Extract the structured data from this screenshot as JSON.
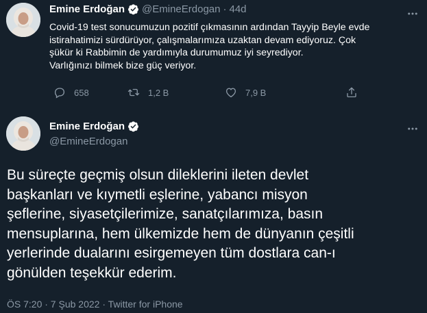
{
  "tweet1": {
    "author_name": "Emine Erdoğan",
    "handle": "@EmineErdogan",
    "separator": "·",
    "age": "44d",
    "text_lines": [
      "Covid-19 test sonucumuzun pozitif çıkmasının ardından Tayyip Beyle evde",
      "istirahatimizi sürdürüyor, çalışmalarımıza uzaktan devam ediyoruz. Çok",
      "şükür ki Rabbimin de yardımıyla durumumuz iyi seyrediyor.",
      "Varlığınızı bilmek bize güç veriyor."
    ],
    "actions": {
      "reply_count": "658",
      "retweet_count": "1,2 B",
      "like_count": "7,9 B"
    }
  },
  "tweet2": {
    "author_name": "Emine Erdoğan",
    "handle": "@EmineErdogan",
    "text_lines": [
      "Bu süreçte geçmiş olsun dileklerini ileten devlet",
      "başkanları ve kıymetli eşlerine, yabancı misyon",
      "şeflerine, siyasetçilerimize, sanatçılarımıza, basın",
      "mensuplarına, hem ülkemizde hem de dünyanın çeşitli",
      "yerlerinde dualarını esirgemeyen tüm dostlara can-ı",
      "gönülden teşekkür ederim."
    ],
    "meta": "ÖS 7:20 · 7 Şub 2022 · Twitter for iPhone"
  },
  "icons": {
    "verified": "verified-badge-icon",
    "more": "more-options-icon",
    "reply": "reply-icon",
    "retweet": "retweet-icon",
    "like": "heart-icon",
    "share": "share-icon"
  },
  "colors": {
    "background": "#15202b",
    "text": "#ffffff",
    "muted": "#8b98a5",
    "verified": "#ffffff"
  }
}
